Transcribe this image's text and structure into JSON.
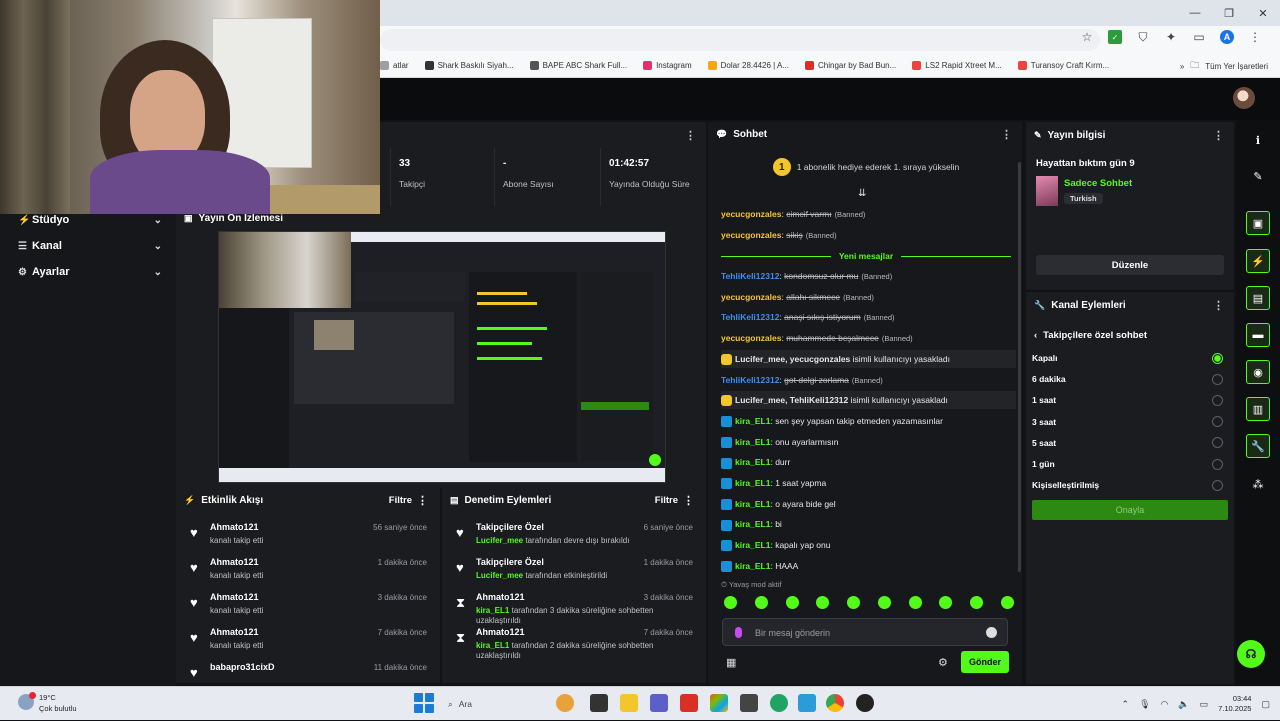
{
  "browser": {
    "window_controls": [
      "—",
      "❐",
      "✕"
    ],
    "bookmarks": [
      {
        "label": "atlar",
        "color": "#9aa0a6"
      },
      {
        "label": "Shark Baskılı Siyah...",
        "color": "#333333"
      },
      {
        "label": "BAPE ABC Shark Full...",
        "color": "#555555"
      },
      {
        "label": "Instagram",
        "color": "#e1306c"
      },
      {
        "label": "Dolar 28.4426 | A...",
        "color": "#f3a713"
      },
      {
        "label": "Chingar by Bad Bun...",
        "color": "#d93025"
      },
      {
        "label": "LS2 Rapid Xtreet M...",
        "color": "#e8453c"
      },
      {
        "label": "Turansoy Craft Kırm...",
        "color": "#e8453c"
      }
    ],
    "bookmarks_more": "»",
    "other_bookmarks": "Tüm Yer İşaretleri"
  },
  "left_nav": {
    "items": [
      {
        "label": "Stüdyo",
        "icon": "⚡"
      },
      {
        "label": "Kanal",
        "icon": "☰"
      },
      {
        "label": "Ayarlar",
        "icon": "⚙"
      }
    ]
  },
  "stats": {
    "followers_value": "33",
    "followers_label": "Takipçi",
    "subs_value": "-",
    "subs_label": "Abone Sayısı",
    "live_value": "01:42:57",
    "live_label": "Yayında Olduğu Süre"
  },
  "preview": {
    "title": "Yayın Ön İzlemesi"
  },
  "activity": {
    "title": "Etkinlik Akışı",
    "filter": "Filtre",
    "items": [
      {
        "user": "Ahmato121",
        "action": "kanalı takip etti",
        "time": "56 saniye önce"
      },
      {
        "user": "Ahmato121",
        "action": "kanalı takip etti",
        "time": "1 dakika önce"
      },
      {
        "user": "Ahmato121",
        "action": "kanalı takip etti",
        "time": "3 dakika önce"
      },
      {
        "user": "Ahmato121",
        "action": "kanalı takip etti",
        "time": "7 dakika önce"
      },
      {
        "user": "babapro31cixD",
        "action": "",
        "time": "11 dakika önce"
      }
    ]
  },
  "moderation": {
    "title": "Denetim Eylemleri",
    "filter": "Filtre",
    "items": [
      {
        "title": "Takipçilere Özel",
        "actor": "Lucifer_mee",
        "rest": "tarafından devre dışı bırakıldı",
        "time": "6 saniye önce"
      },
      {
        "title": "Takipçilere Özel",
        "actor": "Lucifer_mee",
        "rest": "tarafından etkinleştirildi",
        "time": "1 dakika önce"
      },
      {
        "title": "Ahmato121",
        "actor": "kira_EL1",
        "rest": "tarafından 3 dakika süreliğine sohbetten uzaklaştırıldı",
        "time": "3 dakika önce"
      },
      {
        "title": "Ahmato121",
        "actor": "kira_EL1",
        "rest": "tarafından 2 dakika süreliğine sohbetten uzaklaştırıldı",
        "time": "7 dakika önce"
      }
    ]
  },
  "chat": {
    "title": "Sohbet",
    "pinned_rank": "1",
    "pinned_text": "1 abonelik hediye ederek 1. sıraya yükselin",
    "new_messages": "Yeni mesajlar",
    "banned_tag": "(Banned)",
    "messages": [
      {
        "user": "yecucgonzales",
        "text": "cimcif varmı",
        "deleted": true,
        "color": "#f3c72b"
      },
      {
        "user": "yecucgonzales",
        "text": "sikiş",
        "deleted": true,
        "color": "#f3c72b"
      },
      {
        "user": "TehliKeli12312",
        "text": "kondomsuz olur mu",
        "deleted": true,
        "color": "#3d8ef0"
      },
      {
        "user": "yecucgonzales",
        "text": "allahı sikmece",
        "deleted": true,
        "color": "#f3c72b"
      },
      {
        "user": "TehliKeli12312",
        "text": "anaşi sıkış istiyorum",
        "deleted": true,
        "color": "#3d8ef0"
      },
      {
        "user": "yecucgonzales",
        "text": "muhammede bcşalmece",
        "deleted": true,
        "color": "#f3c72b"
      },
      {
        "system_users": "Lucifer_mee, yecucgonzales",
        "system_text": "isimli kullanıcıyı yasakladı"
      },
      {
        "user": "TehliKeli12312",
        "text": "got delgi zorlama",
        "deleted": true,
        "color": "#3d8ef0"
      },
      {
        "system_users": "Lucifer_mee, TehliKeli12312",
        "system_text": "isimli kullanıcıyı yasakladı"
      },
      {
        "user": "kira_EL1",
        "text": "sen şey yapsan takip etmeden yazamasınlar",
        "deleted": false,
        "color": "#53fc18"
      },
      {
        "user": "kira_EL1",
        "text": "onu ayarlarmısın",
        "deleted": false,
        "color": "#53fc18"
      },
      {
        "user": "kira_EL1",
        "text": "durr",
        "deleted": false,
        "color": "#53fc18"
      },
      {
        "user": "kira_EL1",
        "text": "1 saat yapma",
        "deleted": false,
        "color": "#53fc18"
      },
      {
        "user": "kira_EL1",
        "text": "o ayara bide gel",
        "deleted": false,
        "color": "#53fc18"
      },
      {
        "user": "kira_EL1",
        "text": "bi",
        "deleted": false,
        "color": "#53fc18"
      },
      {
        "user": "kira_EL1",
        "text": "kapalı yap onu",
        "deleted": false,
        "color": "#53fc18"
      },
      {
        "user": "kira_EL1",
        "text": "HAAA",
        "deleted": false,
        "color": "#53fc18"
      }
    ],
    "slow_mode": "Yavaş mod aktif",
    "input_placeholder": "Bir mesaj gönderin",
    "send_label": "Gönder"
  },
  "stream_info": {
    "title": "Yayın bilgisi",
    "stream_title": "Hayattan bıktım gün 9",
    "category": "Sadece Sohbet",
    "language": "Turkish",
    "edit_label": "Düzenle"
  },
  "channel_actions": {
    "title": "Kanal Eylemleri",
    "subtitle": "Takipçilere özel sohbet",
    "options": [
      {
        "label": "Kapalı",
        "selected": true
      },
      {
        "label": "6 dakika",
        "selected": false
      },
      {
        "label": "1 saat",
        "selected": false
      },
      {
        "label": "3 saat",
        "selected": false
      },
      {
        "label": "5 saat",
        "selected": false
      },
      {
        "label": "1 gün",
        "selected": false
      },
      {
        "label": "Kişiselleştirilmiş",
        "selected": false
      }
    ],
    "confirm_label": "Onayla"
  },
  "taskbar": {
    "temperature": "19°C",
    "weather": "Çok bulutlu",
    "search": "Ara",
    "time": "03:44",
    "date": "7.10.2025"
  },
  "colors": {
    "accent": "#53fc18",
    "panel": "#1b1c20",
    "background": "#111215"
  }
}
